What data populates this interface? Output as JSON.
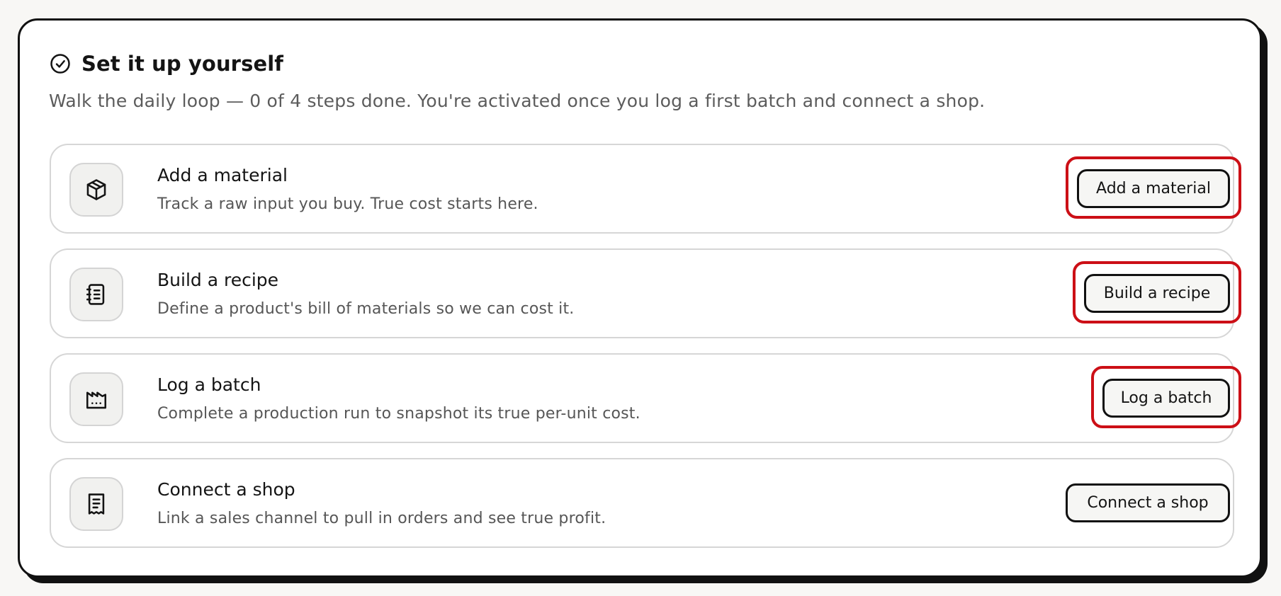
{
  "checklist": {
    "title": "Set it up yourself",
    "subtitle": "Walk the daily loop — 0 of 4 steps done. You're activated once you log a first batch and connect a shop.",
    "steps": [
      {
        "icon": "box-icon",
        "title": "Add a material",
        "description": "Track a raw input you buy. True cost starts here.",
        "button_label": "Add a material",
        "highlighted": true
      },
      {
        "icon": "notebook-icon",
        "title": "Build a recipe",
        "description": "Define a product's bill of materials so we can cost it.",
        "button_label": "Build a recipe",
        "highlighted": true
      },
      {
        "icon": "factory-icon",
        "title": "Log a batch",
        "description": "Complete a production run to snapshot its true per-unit cost.",
        "button_label": "Log a batch",
        "highlighted": true
      },
      {
        "icon": "receipt-icon",
        "title": "Connect a shop",
        "description": "Link a sales channel to pull in orders and see true profit.",
        "button_label": "Connect a shop",
        "highlighted": false
      }
    ]
  },
  "colors": {
    "highlight": "#cc0f16",
    "card_border": "#111111",
    "step_border": "#d6d6d6",
    "subtitle_text": "#5c5c5c"
  }
}
